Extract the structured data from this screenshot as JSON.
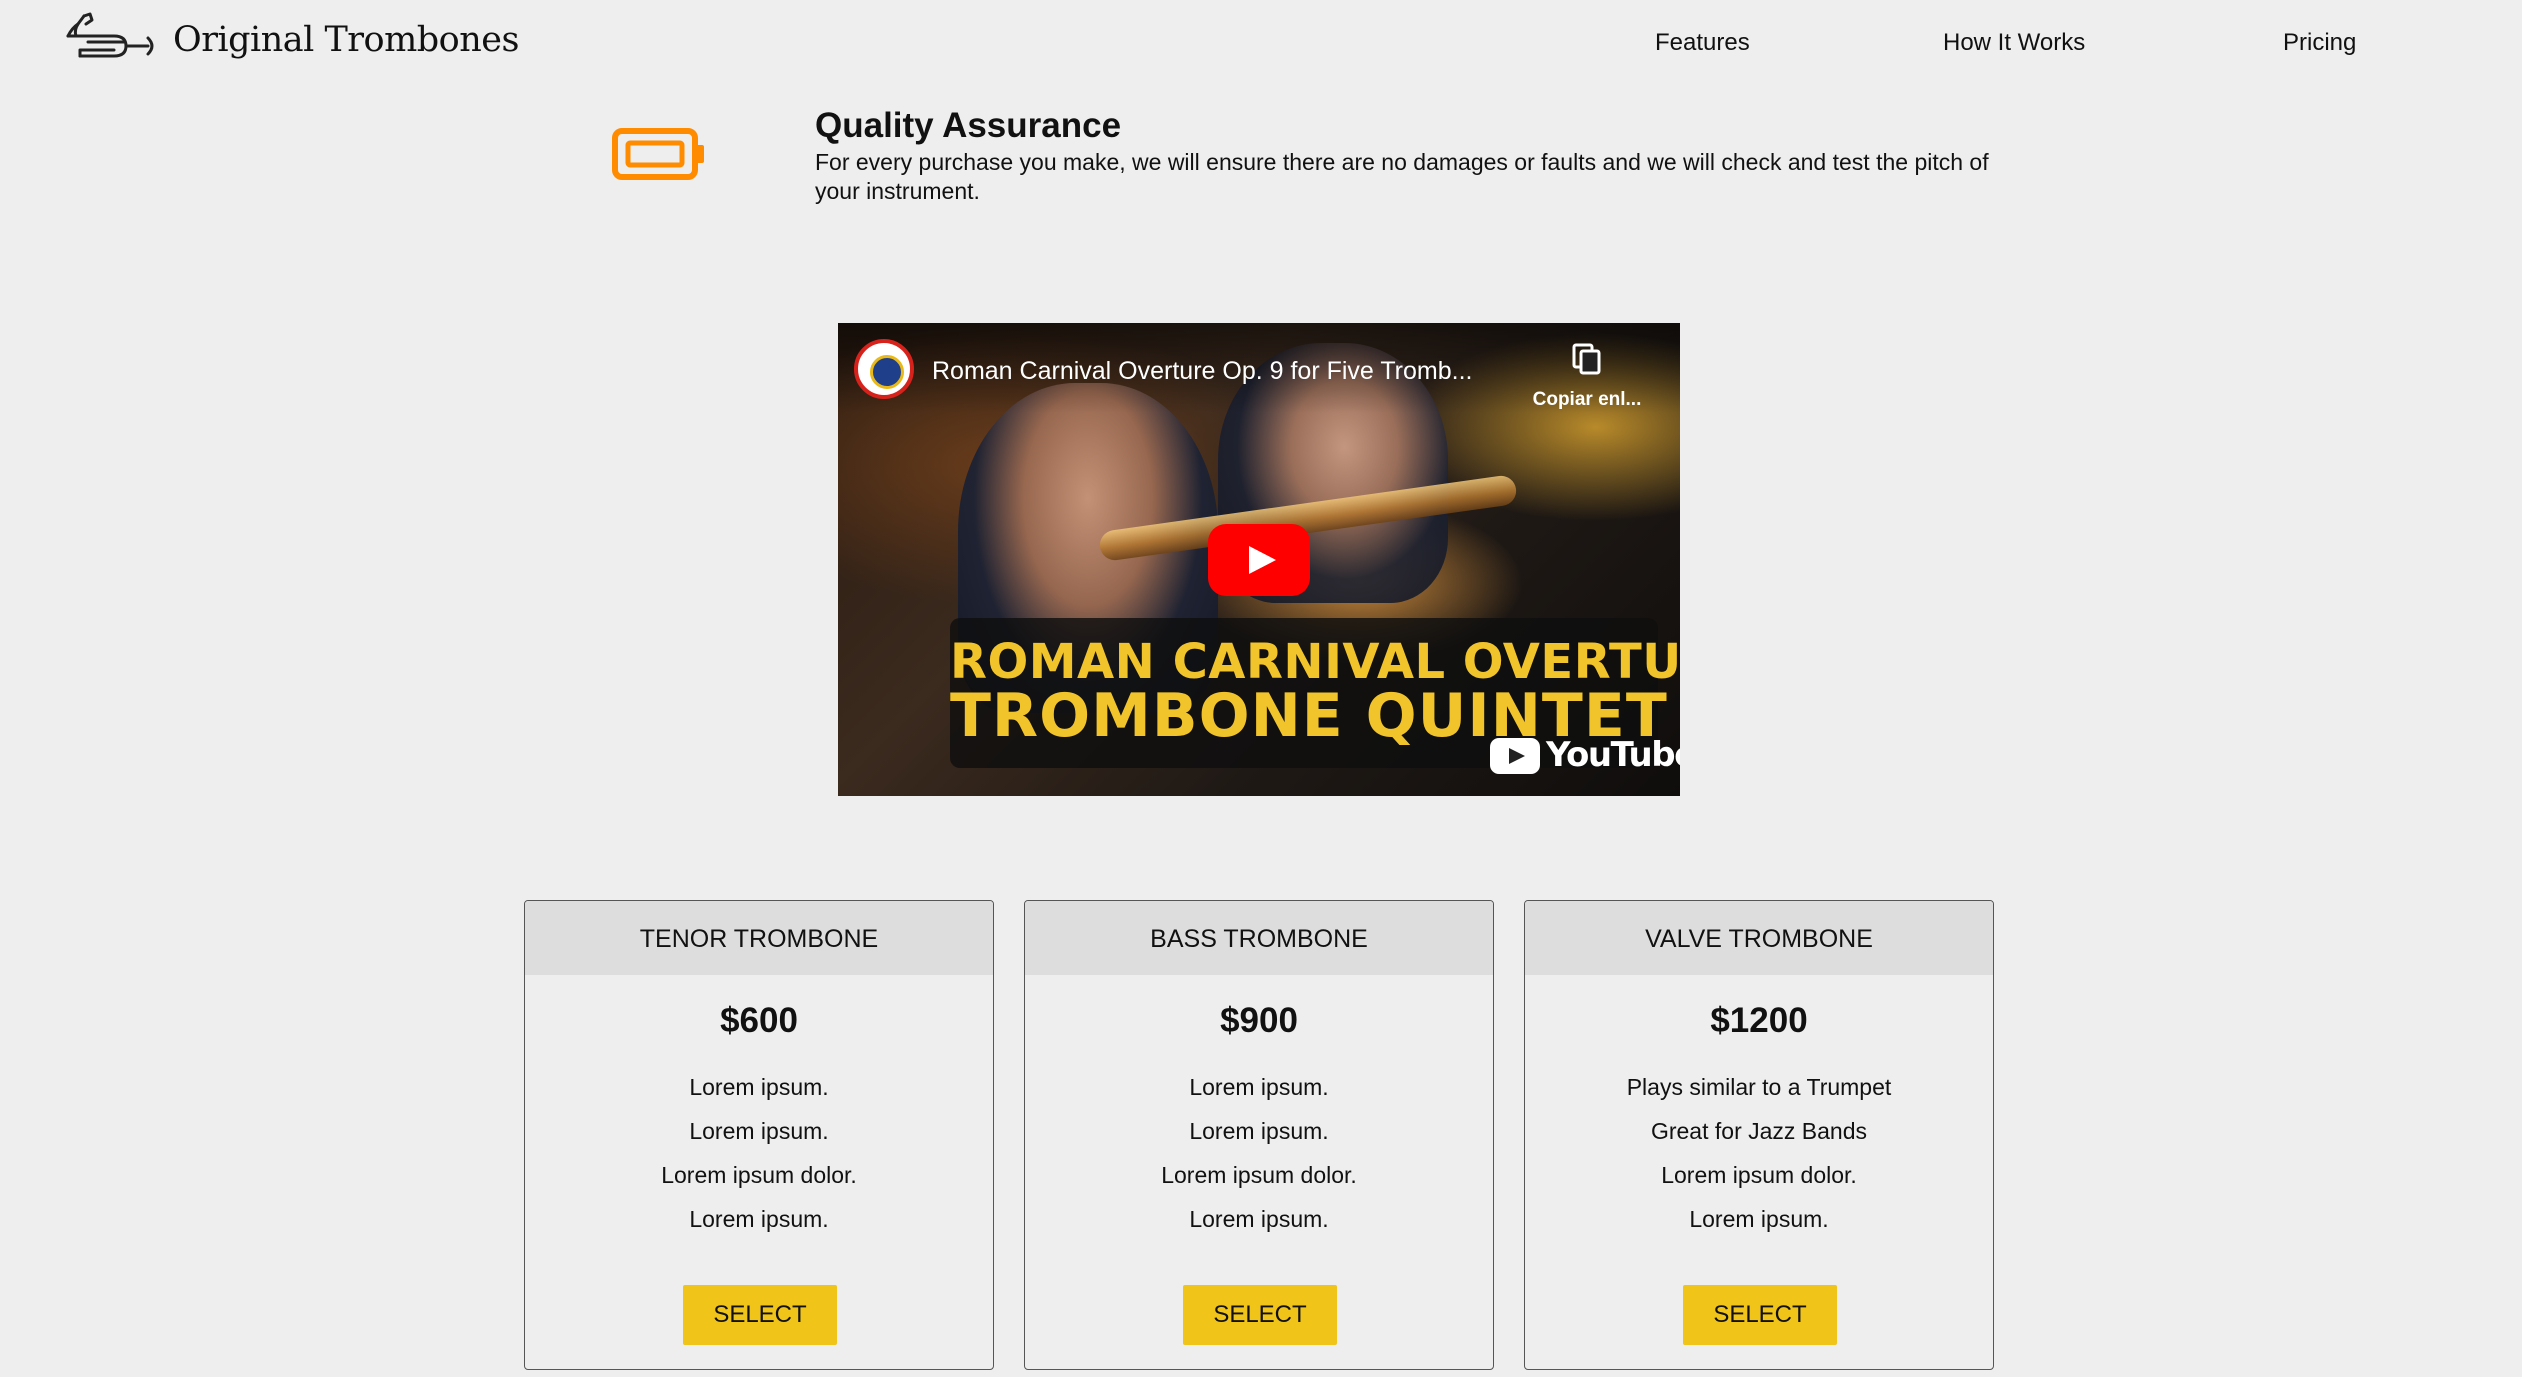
{
  "header": {
    "brand": "Original Trombones",
    "logo_icon": "trombone-icon",
    "nav": [
      {
        "label": "Features"
      },
      {
        "label": "How It Works"
      },
      {
        "label": "Pricing"
      }
    ]
  },
  "quality": {
    "icon": "battery-icon",
    "title": "Quality Assurance",
    "text": "For every purchase you make, we will ensure there are no damages or faults and we will check and test the pitch of your instrument."
  },
  "video": {
    "title": "Roman Carnival Overture Op. 9 for Five Tromb...",
    "copy_label": "Copiar enl...",
    "banner_line1": "ROMAN CARNIVAL OVERTURE",
    "banner_line2": "TROMBONE QUINTET",
    "platform": "YouTube"
  },
  "pricing": {
    "cards": [
      {
        "name": "TENOR TROMBONE",
        "price": "$600",
        "features": [
          "Lorem ipsum.",
          "Lorem ipsum.",
          "Lorem ipsum dolor.",
          "Lorem ipsum."
        ],
        "button": "SELECT"
      },
      {
        "name": "BASS TROMBONE",
        "price": "$900",
        "features": [
          "Lorem ipsum.",
          "Lorem ipsum.",
          "Lorem ipsum dolor.",
          "Lorem ipsum."
        ],
        "button": "SELECT"
      },
      {
        "name": "VALVE TROMBONE",
        "price": "$1200",
        "features": [
          "Plays similar to a Trumpet",
          "Great for Jazz Bands",
          "Lorem ipsum dolor.",
          "Lorem ipsum."
        ],
        "button": "SELECT"
      }
    ]
  },
  "colors": {
    "background": "#eeeeee",
    "accent_yellow": "#f0c419",
    "battery_orange": "#ff8c00",
    "card_header": "#dddddd",
    "youtube_red": "#ff0000"
  }
}
